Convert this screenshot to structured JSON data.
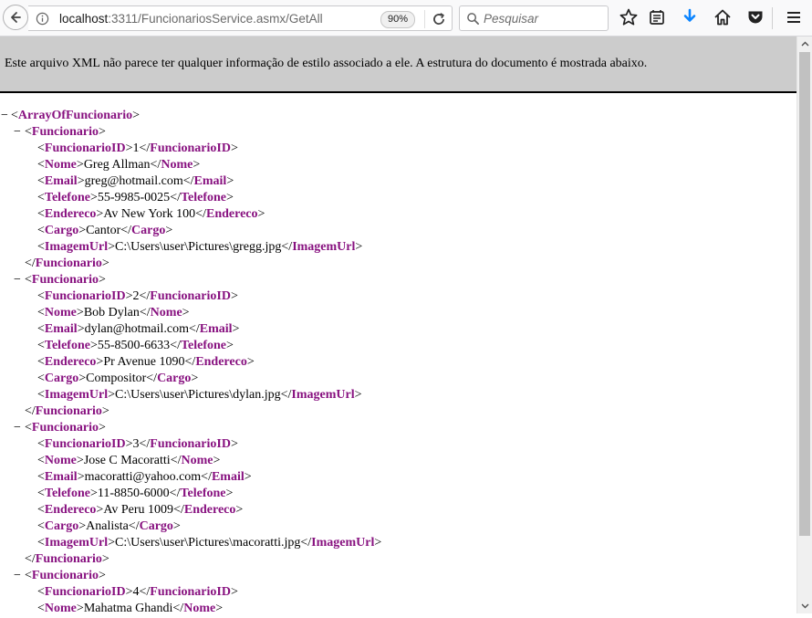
{
  "browser": {
    "url_host": "localhost",
    "url_rest": ":3311/FuncionariosService.asmx/GetAll",
    "zoom": "90%",
    "search_placeholder": "Pesquisar",
    "icons": [
      "back-icon",
      "info-icon",
      "reload-icon",
      "search-icon",
      "star-icon",
      "reader-icon",
      "download-icon",
      "home-icon",
      "pocket-icon",
      "menu-icon"
    ],
    "download_color": "#0a84ff"
  },
  "infobar": {
    "message": "Este arquivo XML não parece ter qualquer informação de estilo associado a ele. A estrutura do documento é mostrada abaixo."
  },
  "xml": {
    "collapse_glyph": "−",
    "root_tag": "ArrayOfFuncionario",
    "item_tag": "Funcionario",
    "tag_color": "#881280",
    "funcionarios": [
      {
        "FuncionarioID": "1",
        "Nome": "Greg Allman",
        "Email": "greg@hotmail.com",
        "Telefone": "55-9985-0025",
        "Endereco": "Av New York 100",
        "Cargo": "Cantor",
        "ImagemUrl": "C:\\Users\\user\\Pictures\\gregg.jpg"
      },
      {
        "FuncionarioID": "2",
        "Nome": "Bob Dylan",
        "Email": "dylan@hotmail.com",
        "Telefone": "55-8500-6633",
        "Endereco": "Pr Avenue 1090",
        "Cargo": "Compositor",
        "ImagemUrl": "C:\\Users\\user\\Pictures\\dylan.jpg"
      },
      {
        "FuncionarioID": "3",
        "Nome": "Jose C Macoratti",
        "Email": "macoratti@yahoo.com",
        "Telefone": "11-8850-6000",
        "Endereco": "Av Peru 1009",
        "Cargo": "Analista",
        "ImagemUrl": "C:\\Users\\user\\Pictures\\macoratti.jpg"
      },
      {
        "FuncionarioID": "4",
        "Nome": "Mahatma Ghandi"
      }
    ]
  }
}
